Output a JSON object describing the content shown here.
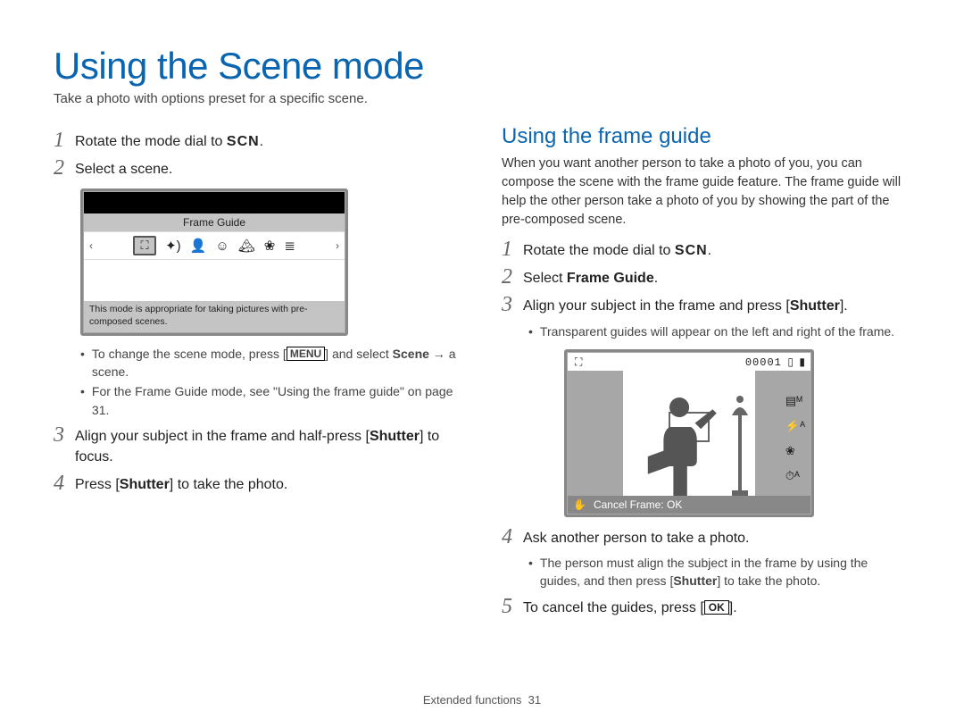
{
  "page": {
    "title": "Using the Scene mode",
    "subtitle": "Take a photo with options preset for a specific scene.",
    "footer_section": "Extended functions",
    "footer_page": "31"
  },
  "scn_label": "SCN",
  "menu_label": "MENU",
  "ok_label": "OK",
  "left": {
    "step1": "Rotate the mode dial to ",
    "step1_tail": ".",
    "step2": "Select a scene.",
    "lcd": {
      "label": "Frame Guide",
      "desc": "This mode is appropriate for taking pictures with pre-composed scenes."
    },
    "bullets": {
      "b1_a": "To change the scene mode, press [",
      "b1_b": "] and select ",
      "b1_c": "Scene",
      "b1_d": " → a scene.",
      "b2": "For the Frame Guide mode, see \"Using the frame guide\" on page 31."
    },
    "step3_a": "Align your subject in the frame and half-press [",
    "step3_b": "Shutter",
    "step3_c": "] to focus.",
    "step4_a": "Press [",
    "step4_b": "Shutter",
    "step4_c": "] to take the photo."
  },
  "right": {
    "heading": "Using the frame guide",
    "para": "When you want another person to take a photo of you, you can compose the scene with the frame guide feature. The frame guide will help the other person take a photo of you by showing the part of the pre-composed scene.",
    "step1": "Rotate the mode dial to ",
    "step1_tail": ".",
    "step2_a": "Select ",
    "step2_b": "Frame Guide",
    "step2_c": ".",
    "step3_a": "Align your subject in the frame and press [",
    "step3_b": "Shutter",
    "step3_c": "].",
    "step3_bullet": "Transparent guides will appear on the left and right of the frame.",
    "lcd": {
      "counter": "00001",
      "bottom_text": "Cancel Frame: OK"
    },
    "step4": "Ask another person to take a photo.",
    "step4_bullet_a": "The person must align the subject in the frame by using the guides, and then press [",
    "step4_bullet_b": "Shutter",
    "step4_bullet_c": "] to take the photo.",
    "step5_a": "To cancel the guides, press [",
    "step5_b": "]."
  }
}
